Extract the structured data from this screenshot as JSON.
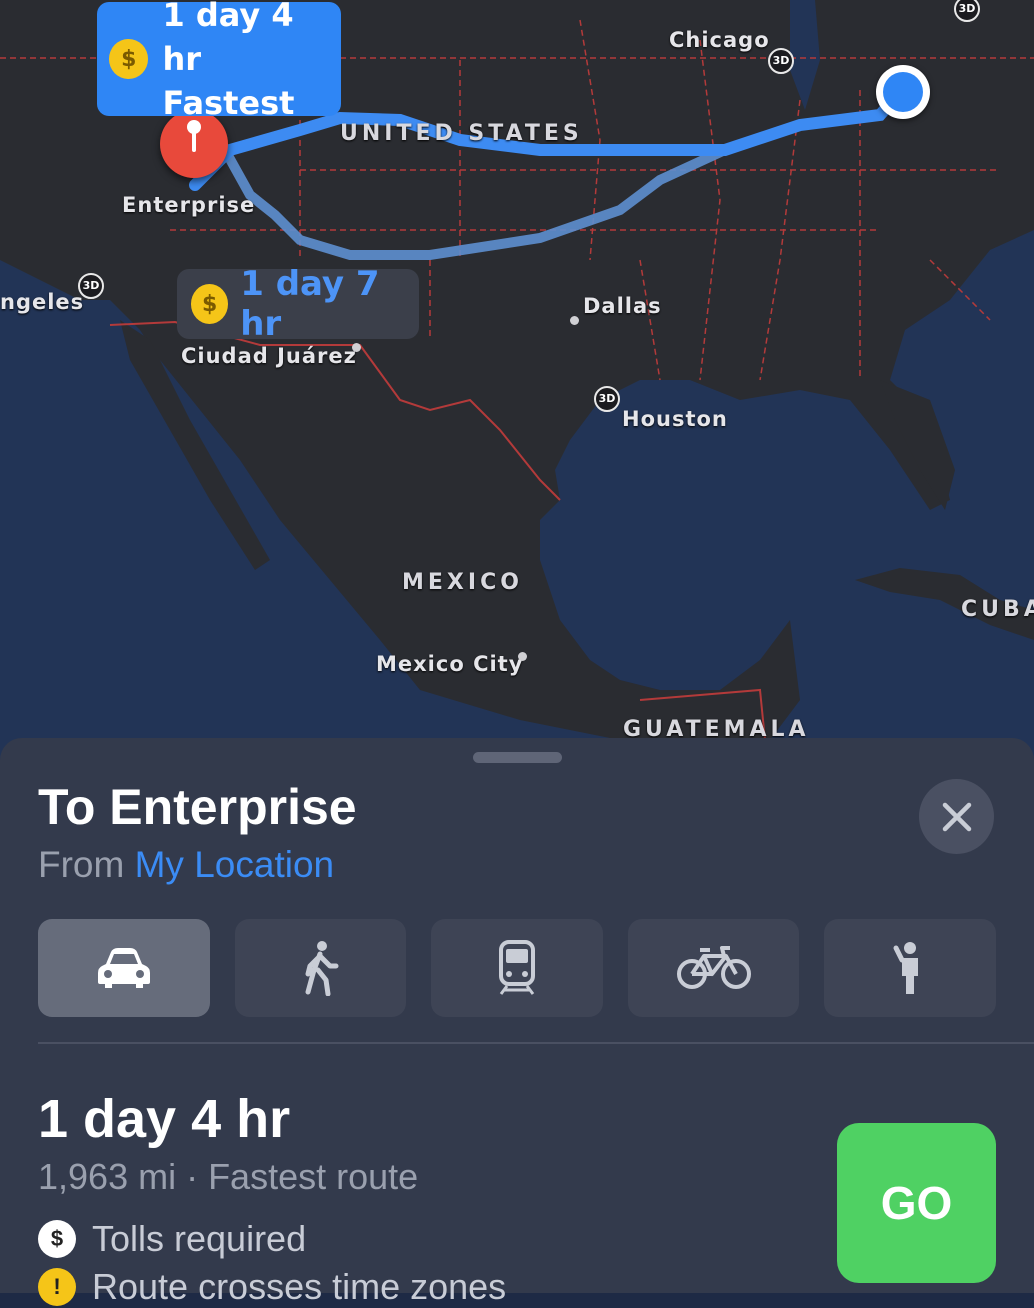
{
  "map": {
    "cities": {
      "chicago": "Chicago",
      "enterprise": "Enterprise",
      "los_angeles": "ngeles",
      "dallas": "Dallas",
      "ciudad_juarez": "Ciudad Juárez",
      "houston": "Houston",
      "mexico_city": "Mexico City"
    },
    "countries": {
      "united_states": "UNITED STATES",
      "mexico": "MEXICO",
      "cuba": "CUBA",
      "guatemala": "GUATEMALA"
    },
    "badge_3d": "3D",
    "route_primary": {
      "duration": "1 day 4 hr",
      "tag": "Fastest",
      "toll_icon": "$"
    },
    "route_alternate": {
      "duration": "1 day 7 hr",
      "toll_icon": "$"
    },
    "colors": {
      "route": "#3d8bf2",
      "land": "#2a2c31",
      "water": "#223456",
      "border": "#b33a3a"
    }
  },
  "sheet": {
    "title": "To Enterprise",
    "from_label": "From",
    "from_value": "My Location",
    "modes": [
      {
        "id": "drive",
        "icon": "car-icon",
        "active": true
      },
      {
        "id": "walk",
        "icon": "walking-icon",
        "active": false
      },
      {
        "id": "transit",
        "icon": "train-icon",
        "active": false
      },
      {
        "id": "cycle",
        "icon": "bicycle-icon",
        "active": false
      },
      {
        "id": "ride",
        "icon": "rideshare-icon",
        "active": false
      }
    ],
    "eta": "1 day 4 hr",
    "details": "1,963 mi · Fastest route",
    "notes": [
      {
        "icon": "$",
        "text": "Tolls required"
      },
      {
        "icon": "!",
        "text": "Route crosses time zones"
      }
    ],
    "go_label": "GO",
    "colors": {
      "go": "#4fd163",
      "link": "#3b8cf5"
    }
  }
}
